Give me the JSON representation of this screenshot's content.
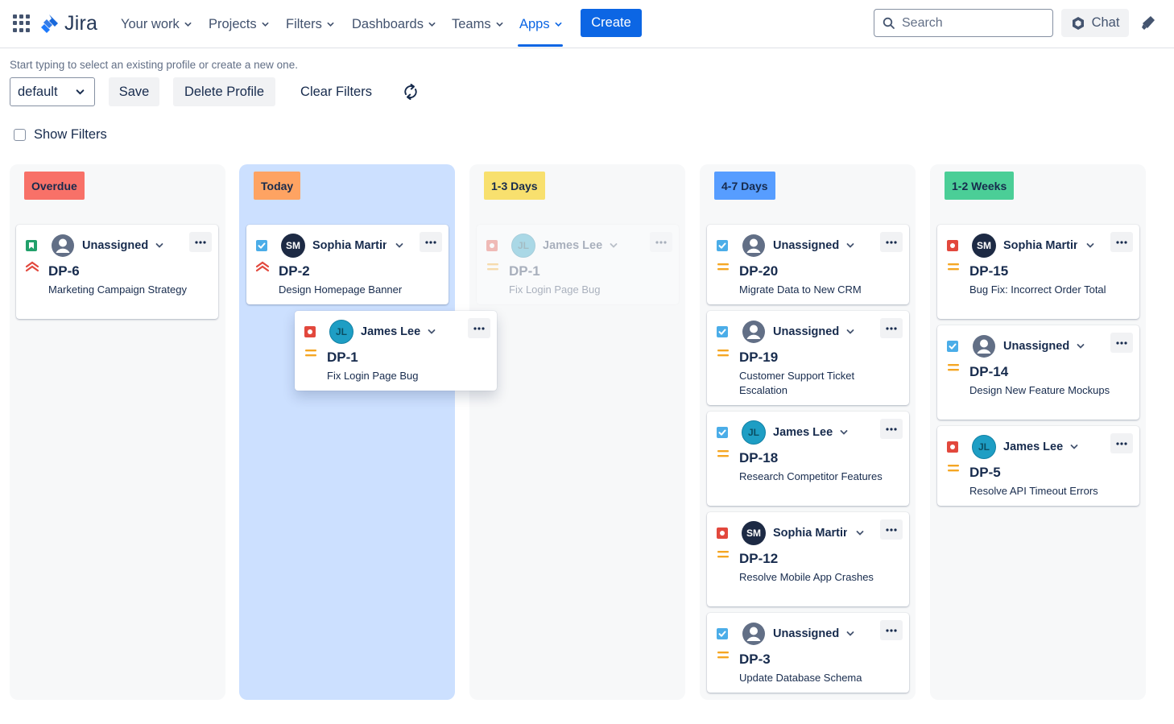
{
  "header": {
    "logo_text": "Jira",
    "nav": [
      {
        "label": "Your work"
      },
      {
        "label": "Projects"
      },
      {
        "label": "Filters"
      },
      {
        "label": "Dashboards"
      },
      {
        "label": "Teams"
      },
      {
        "label": "Apps",
        "active": true
      }
    ],
    "create_label": "Create",
    "search_placeholder": "Search",
    "chat_label": "Chat"
  },
  "toolbar": {
    "hint": "Start typing to select an existing profile or create a new one.",
    "profile_value": "default",
    "save_label": "Save",
    "delete_label": "Delete Profile",
    "clear_label": "Clear Filters",
    "show_filters_label": "Show Filters"
  },
  "colors": {
    "accent": "#0c66e4",
    "overdue": "#f87168",
    "today": "#fea362",
    "days_1_3": "#f8e06e",
    "days_4_7": "#579dff",
    "weeks_1_2": "#4bce97",
    "today_column_bg": "#cce0ff"
  },
  "board": {
    "columns": [
      {
        "label": "Overdue",
        "cards": [
          {
            "key": "DP-6",
            "summary": "Marketing Campaign Strategy",
            "assignee": "Unassigned",
            "avatar": "unassigned",
            "type_icon": "story-icon",
            "priority_icon": "priority-highest-icon"
          }
        ]
      },
      {
        "label": "Today",
        "cards": [
          {
            "key": "DP-2",
            "summary": "Design Homepage Banner",
            "assignee": "Sophia Martin",
            "avatar": "SM",
            "type_icon": "task-icon",
            "priority_icon": "priority-highest-icon"
          },
          {
            "key": "DP-1",
            "summary": "Fix Login Page Bug",
            "assignee": "James Lee",
            "avatar": "JL",
            "type_icon": "bug-icon",
            "priority_icon": "priority-medium-icon",
            "state": "dragging"
          }
        ]
      },
      {
        "label": "1-3 Days",
        "cards": [
          {
            "key": "DP-1",
            "summary": "Fix Login Page Bug",
            "assignee": "James Lee",
            "avatar": "JL",
            "type_icon": "bug-icon",
            "priority_icon": "priority-medium-icon",
            "state": "drag-placeholder"
          }
        ]
      },
      {
        "label": "4-7 Days",
        "cards": [
          {
            "key": "DP-20",
            "summary": "Migrate Data to New CRM",
            "assignee": "Unassigned",
            "avatar": "unassigned",
            "type_icon": "task-icon",
            "priority_icon": "priority-medium-icon"
          },
          {
            "key": "DP-19",
            "summary": "Customer Support Ticket Escalation",
            "assignee": "Unassigned",
            "avatar": "unassigned",
            "type_icon": "task-icon",
            "priority_icon": "priority-medium-icon"
          },
          {
            "key": "DP-18",
            "summary": "Research Competitor Features",
            "assignee": "James Lee",
            "avatar": "JL",
            "type_icon": "task-icon",
            "priority_icon": "priority-medium-icon"
          },
          {
            "key": "DP-12",
            "summary": "Resolve Mobile App Crashes",
            "assignee": "Sophia Martin",
            "avatar": "SM",
            "type_icon": "bug-icon",
            "priority_icon": "priority-medium-icon"
          },
          {
            "key": "DP-3",
            "summary": "Update Database Schema",
            "assignee": "Unassigned",
            "avatar": "unassigned",
            "type_icon": "task-icon",
            "priority_icon": "priority-medium-icon"
          }
        ]
      },
      {
        "label": "1-2 Weeks",
        "cards": [
          {
            "key": "DP-15",
            "summary": "Bug Fix: Incorrect Order Total",
            "assignee": "Sophia Martin",
            "avatar": "SM",
            "type_icon": "bug-icon",
            "priority_icon": "priority-medium-icon"
          },
          {
            "key": "DP-14",
            "summary": "Design New Feature Mockups",
            "assignee": "Unassigned",
            "avatar": "unassigned",
            "type_icon": "task-icon",
            "priority_icon": "priority-medium-icon"
          },
          {
            "key": "DP-5",
            "summary": "Resolve API Timeout Errors",
            "assignee": "James Lee",
            "avatar": "JL",
            "type_icon": "bug-icon",
            "priority_icon": "priority-medium-icon"
          }
        ]
      }
    ]
  }
}
